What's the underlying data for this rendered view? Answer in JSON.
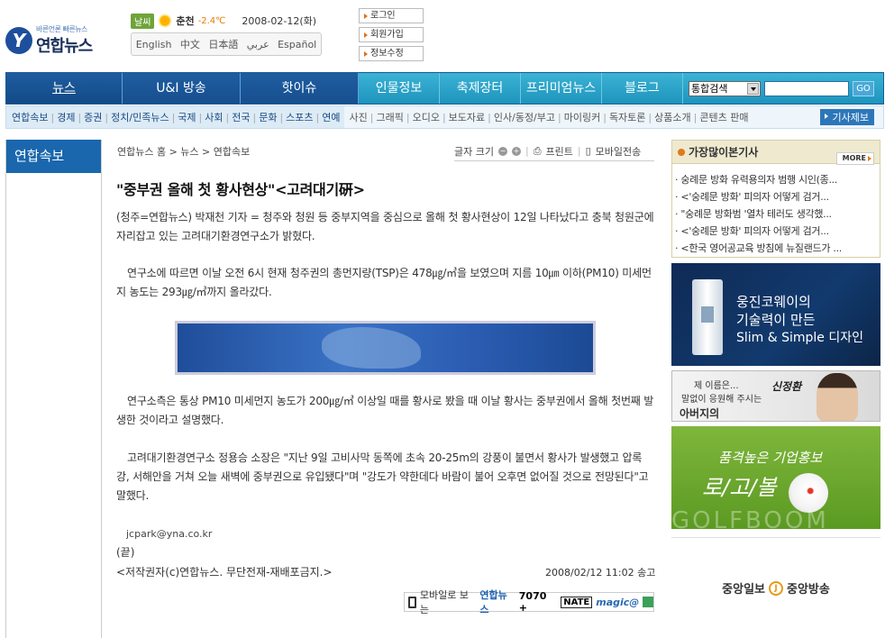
{
  "header": {
    "logo": {
      "slogan": "바른언론 빠른뉴스",
      "name": "연합뉴스"
    },
    "weather": {
      "badge": "날씨",
      "city": "춘천",
      "temp": "-2.4℃",
      "date": "2008-02-12(화)"
    },
    "languages": [
      "English",
      "中文",
      "日本語",
      "عربي",
      "Español"
    ],
    "links": {
      "login": "로그인",
      "join": "회원가입",
      "edit": "정보수정"
    }
  },
  "nav": {
    "main": [
      "뉴스",
      "U&I 방송",
      "핫이슈",
      "인물정보",
      "축제장터",
      "프리미엄뉴스",
      "블로그"
    ],
    "search_select": "통합검색",
    "go": "GO"
  },
  "subnav": {
    "left": [
      "연합속보",
      "경제",
      "증권",
      "정치/민족뉴스",
      "국제",
      "사회",
      "전국",
      "문화",
      "스포츠",
      "연예"
    ],
    "right": [
      "사진",
      "그래픽",
      "오디오",
      "보도자료",
      "인사/동정/부고",
      "마이링커",
      "독자토론",
      "상품소개",
      "콘텐츠 판매"
    ],
    "report_button": "기사제보"
  },
  "sidebar": {
    "title": "연합속보"
  },
  "article": {
    "breadcrumb": "연합뉴스 홈 > 뉴스 > 연합속보",
    "tools": {
      "font_size": "글자 크기",
      "print": "프린트",
      "mobile": "모바일전송"
    },
    "headline": "\"중부권 올해 첫 황사현상\"<고려대기硏>",
    "paragraphs": [
      "(청주=연합뉴스) 박재천 기자 = 청주와 청원 등 중부지역을 중심으로 올해 첫 황사현상이 12일 나타났다고 충북 청원군에 자리잡고 있는 고려대기환경연구소가 밝혔다.",
      "연구소에 따르면 이날 오전 6시 현재 청주권의 총먼지량(TSP)은 478㎍/㎥을 보였으며 지름 10㎛ 이하(PM10) 미세먼지 농도는 293㎍/㎥까지 올라갔다.",
      "연구소측은 통상 PM10 미세먼지 농도가 200㎍/㎥ 이상일 때를 황사로 봤을 때 이날 황사는 중부권에서 올해 첫번째 발생한 것이라고 설명했다.",
      "고려대기환경연구소 정용승 소장은 \"지난 9일 고비사막 동쪽에 초속 20-25m의 강풍이 불면서 황사가 발생했고 압록강, 서해안을 거쳐 오늘 새벽에 중부권으로 유입됐다\"며 \"강도가 약한데다 바람이 불어 오후면 없어질 것으로 전망된다\"고 말했다."
    ],
    "email": "jcpark@yna.co.kr",
    "end": "(끝)",
    "copyright": "<저작권자(c)연합뉴스. 무단전재-재배포금지.>",
    "sent_time": "2008/02/12 11:02 송고",
    "mobile_bar": {
      "label": "모바일로 보는",
      "brand": "연합뉴스",
      "number": "7070 +",
      "nate": "NATE",
      "magic": "magic@"
    }
  },
  "popular": {
    "title": "가장많이본기사",
    "more": "MORE",
    "items": [
      "숭례문 방화 유력용의자 범행 시인(종...",
      "<'숭례문 방화' 피의자 어떻게 검거...",
      "\"숭례문 방화범 '열차 테러도 생각했...",
      "<'숭례문 방화' 피의자 어떻게 검거...",
      "<한국 영어공교육 방침에 뉴질랜드가 ..."
    ]
  },
  "ads": {
    "coway": {
      "line1": "웅진코웨이의",
      "line2": "기술력이 만든",
      "line3": "Slim & Simple 디자인"
    },
    "father": {
      "line1": "제 이름은...",
      "line2": "말없이 응원해 주시는",
      "line3": "아버지의",
      "sign": "신정환"
    },
    "golf": {
      "line1": "품격높은 기업홍보",
      "line2": "로/고/볼",
      "bg": "GOLFBOOM"
    },
    "joongang": {
      "left": "중앙일보",
      "right": "중앙방송",
      "mark": "J"
    }
  }
}
